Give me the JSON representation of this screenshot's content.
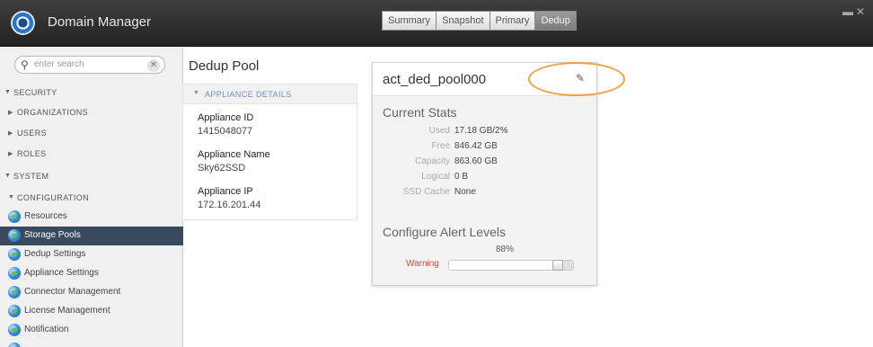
{
  "header": {
    "app_title": "Domain Manager",
    "tabs": [
      {
        "label": "Summary",
        "active": false
      },
      {
        "label": "Snapshot",
        "active": false
      },
      {
        "label": "Primary",
        "active": false
      },
      {
        "label": "Dedup",
        "active": true
      }
    ]
  },
  "sidebar": {
    "search_placeholder": "enter search",
    "sections": [
      {
        "label": "SECURITY",
        "expanded": true
      },
      {
        "label": "ORGANIZATIONS",
        "expanded": false
      },
      {
        "label": "USERS",
        "expanded": false
      },
      {
        "label": "ROLES",
        "expanded": false
      },
      {
        "label": "SYSTEM",
        "expanded": true
      },
      {
        "label": "CONFIGURATION",
        "expanded": true
      }
    ],
    "items": [
      {
        "label": "Resources",
        "active": false
      },
      {
        "label": "Storage Pools",
        "active": true
      },
      {
        "label": "Dedup Settings",
        "active": false
      },
      {
        "label": "Appliance Settings",
        "active": false
      },
      {
        "label": "Connector Management",
        "active": false
      },
      {
        "label": "License Management",
        "active": false
      },
      {
        "label": "Notification",
        "active": false
      }
    ]
  },
  "main": {
    "title": "Dedup Pool",
    "details": {
      "header": "APPLIANCE DETAILS",
      "fields": [
        {
          "label": "Appliance ID",
          "value": "1415048077"
        },
        {
          "label": "Appliance Name",
          "value": "Sky62SSD"
        },
        {
          "label": "Appliance IP",
          "value": "172.16.201.44"
        }
      ]
    },
    "pool": {
      "name": "act_ded_pool000",
      "current_stats_title": "Current Stats",
      "stats": [
        {
          "label": "Used",
          "value": "17.18 GB/2%"
        },
        {
          "label": "Free",
          "value": "846.42 GB"
        },
        {
          "label": "Capacity",
          "value": "863.60 GB"
        },
        {
          "label": "Logical",
          "value": "0 B"
        },
        {
          "label": "SSD Cache",
          "value": "None"
        }
      ],
      "alert_title": "Configure Alert Levels",
      "warning_label": "Warning",
      "warning_percent_text": "88%",
      "warning_level": 0.88
    }
  },
  "colors": {
    "accent_active": "#3a4a5e",
    "warning": "#d24b3c",
    "highlight": "#f0a040",
    "link_header": "#6b8fc4"
  },
  "icons": [
    "app-logo-icon",
    "search-icon",
    "clear-icon",
    "caret-icon",
    "settings-node-icon",
    "pencil-icon",
    "window-controls-icon"
  ]
}
